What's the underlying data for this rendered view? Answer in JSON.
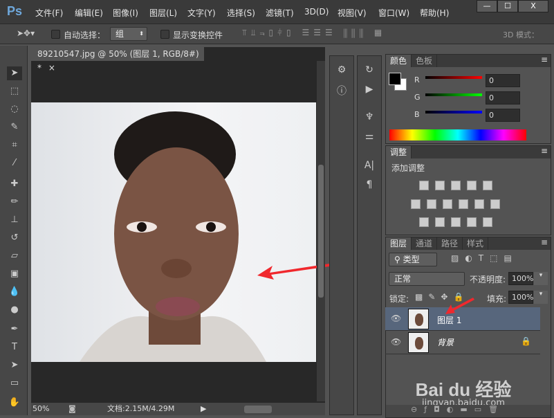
{
  "app": {
    "logo": "Ps",
    "window_buttons": [
      "—",
      "☐",
      "X"
    ]
  },
  "menu": [
    "文件(F)",
    "编辑(E)",
    "图像(I)",
    "图层(L)",
    "文字(Y)",
    "选择(S)",
    "滤镜(T)",
    "3D(D)",
    "视图(V)",
    "窗口(W)",
    "帮助(H)"
  ],
  "options": {
    "auto_select_label": "自动选择：",
    "auto_select_value": "组",
    "show_transform_label": "显示变换控件",
    "mode_3d_label": "3D 模式："
  },
  "document": {
    "tab_title": "89210547.jpg @ 50% (图层 1, RGB/8#) *",
    "close": "×",
    "zoom": "50%",
    "doc_info": "文档:2.15M/4.29M"
  },
  "color_panel": {
    "tabs": [
      "颜色",
      "色板"
    ],
    "channels": [
      {
        "name": "R",
        "value": "0",
        "color": "#ff0000"
      },
      {
        "name": "G",
        "value": "0",
        "color": "#00ff00"
      },
      {
        "name": "B",
        "value": "0",
        "color": "#0000ff"
      }
    ],
    "foreground": "#000000",
    "background": "#ffffff"
  },
  "adjustments_panel": {
    "tab": "调整",
    "title": "添加调整"
  },
  "layers_panel": {
    "tabs": [
      "图层",
      "通道",
      "路径",
      "样式"
    ],
    "filter_label": "类型",
    "blend_mode": "正常",
    "opacity_label": "不透明度:",
    "opacity": "100%",
    "lock_label": "锁定:",
    "fill_label": "填充:",
    "fill": "100%",
    "layers": [
      {
        "name": "图层 1",
        "selected": true,
        "visible": true
      },
      {
        "name": "背景",
        "selected": false,
        "visible": true,
        "locked": true
      }
    ]
  },
  "watermark": {
    "brand": "Bai du 经验",
    "url": "jingyan.baidu.com"
  },
  "annotation_color": "#f0282d"
}
